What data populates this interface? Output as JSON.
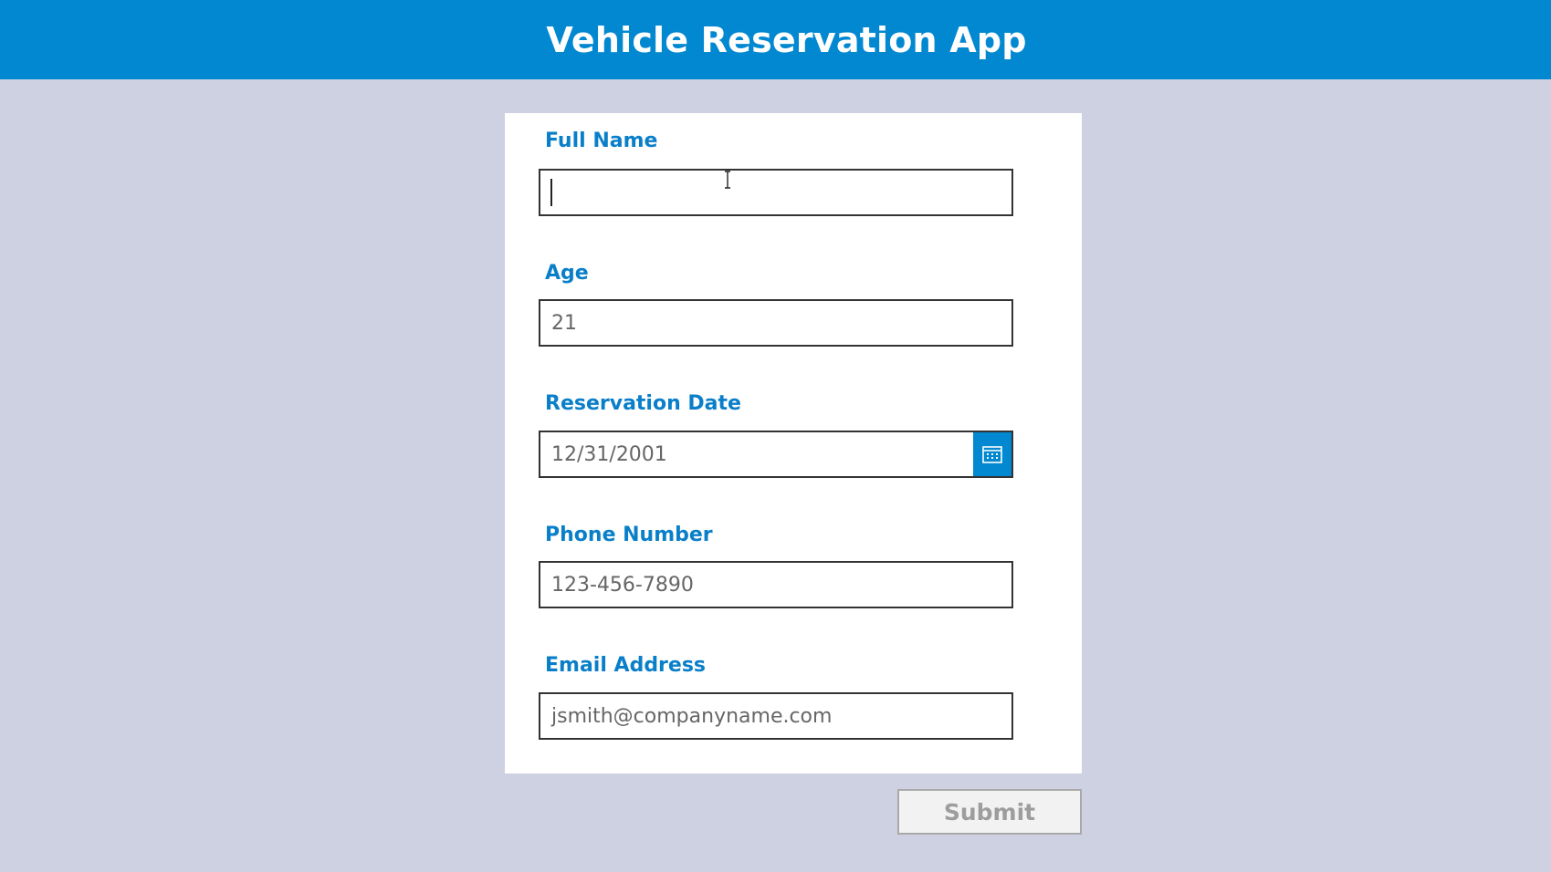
{
  "header": {
    "title": "Vehicle Reservation App"
  },
  "form": {
    "full_name": {
      "label": "Full Name",
      "value": ""
    },
    "age": {
      "label": "Age",
      "value": "21"
    },
    "reservation_date": {
      "label": "Reservation Date",
      "value": "12/31/2001"
    },
    "phone": {
      "label": "Phone Number",
      "value": "123-456-7890"
    },
    "email": {
      "label": "Email Address",
      "value": "jsmith@companyname.com"
    }
  },
  "submit_label": "Submit",
  "colors": {
    "accent": "#0288d1",
    "background": "#ced1e2",
    "label": "#0a7fc9"
  },
  "icons": {
    "calendar": "calendar-icon",
    "cursor": "text-cursor-icon"
  }
}
